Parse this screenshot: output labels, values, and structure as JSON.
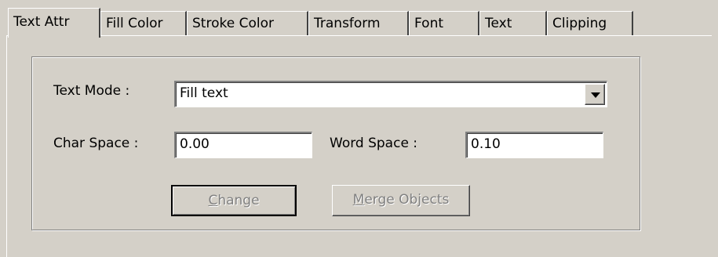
{
  "tabs": [
    {
      "label": "Text Attr",
      "active": true
    },
    {
      "label": "Fill Color",
      "active": false
    },
    {
      "label": "Stroke Color",
      "active": false
    },
    {
      "label": "Transform",
      "active": false
    },
    {
      "label": "Font",
      "active": false
    },
    {
      "label": "Text",
      "active": false
    },
    {
      "label": "Clipping",
      "active": false
    }
  ],
  "text_mode": {
    "label": "Text Mode :",
    "value": "Fill text"
  },
  "char_space": {
    "label": "Char Space :",
    "value": "0.00"
  },
  "word_space": {
    "label": "Word Space :",
    "value": "0.10"
  },
  "buttons": {
    "change": {
      "mnemonic": "C",
      "rest": "hange",
      "enabled": false
    },
    "merge": {
      "mnemonic": "M",
      "rest": "erge Objects",
      "enabled": false
    }
  },
  "colors": {
    "face": "#d4d0c8",
    "disabled_text": "#808080"
  }
}
